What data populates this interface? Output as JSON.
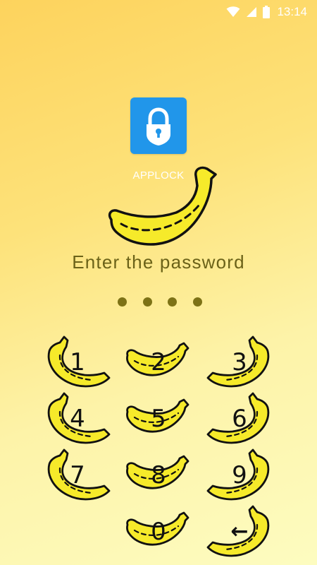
{
  "status_bar": {
    "time": "13:14",
    "icons": [
      "wifi-icon",
      "cell-signal-icon",
      "battery-icon"
    ]
  },
  "app": {
    "name": "APPLOCK",
    "icon": "padlock-icon",
    "icon_color": "#2196ea"
  },
  "prompt": "Enter the password",
  "pin": {
    "length": 4,
    "entered": 0
  },
  "keypad": {
    "keys": [
      "1",
      "2",
      "3",
      "4",
      "5",
      "6",
      "7",
      "8",
      "9",
      "0",
      "←"
    ],
    "key_style": "banana-icon"
  },
  "colors": {
    "banana_fill": "#f6ea2a",
    "banana_outline": "#111111",
    "prompt_text": "#6b6218",
    "dots": "#7d7216",
    "background_top": "#fdd35d",
    "background_bottom": "#fdfcc0"
  }
}
